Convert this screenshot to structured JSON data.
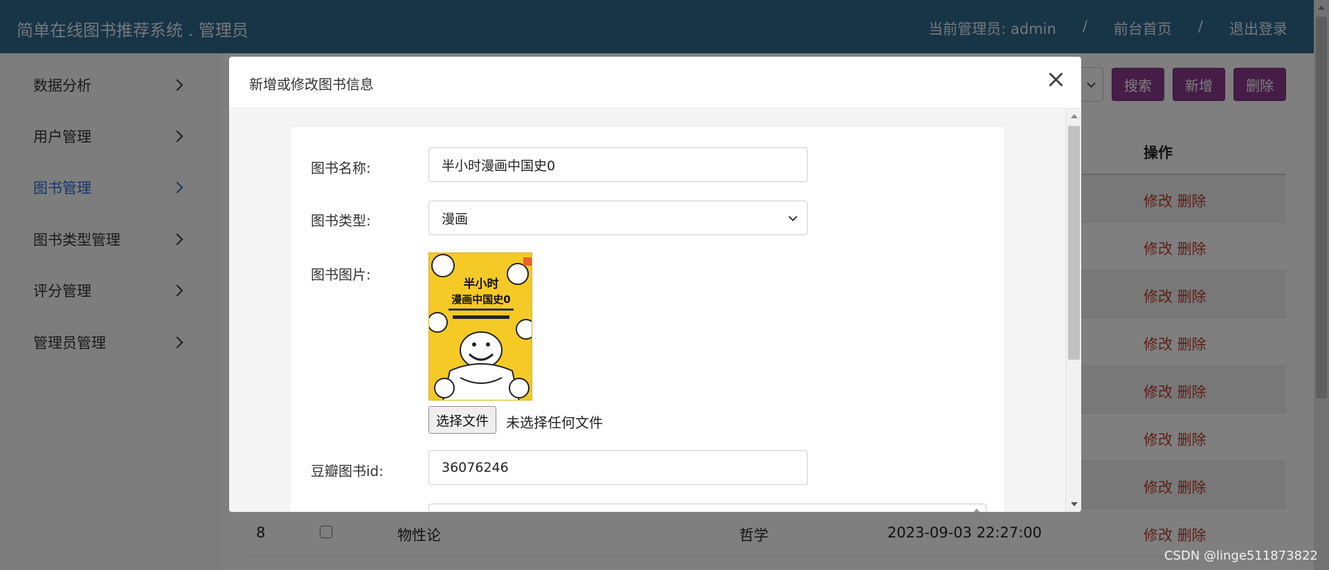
{
  "header": {
    "title": "简单在线图书推荐系统 . 管理员",
    "current_admin": "当前管理员:  admin",
    "sep1": "/",
    "home": "前台首页",
    "sep2": "/",
    "logout": "退出登录"
  },
  "sidebar": {
    "items": [
      {
        "label": "数据分析"
      },
      {
        "label": "用户管理"
      },
      {
        "label": "图书管理"
      },
      {
        "label": "图书类型管理"
      },
      {
        "label": "评分管理"
      },
      {
        "label": "管理员管理"
      }
    ]
  },
  "toolbar": {
    "search_label": "搜索",
    "add_label": "新增",
    "delete_label": "删除"
  },
  "table": {
    "op_header": "操作",
    "edit_label": "修改",
    "delete_label": "删除",
    "last_row": {
      "id": "8",
      "name": "物性论",
      "type": "哲学",
      "time": "2023-09-03 22:27:00"
    }
  },
  "modal": {
    "title": "新增或修改图书信息",
    "fields": {
      "name_label": "图书名称:",
      "name_value": "半小时漫画中国史0",
      "type_label": "图书类型:",
      "type_value": "漫画",
      "image_label": "图书图片:",
      "file_button": "选择文件",
      "file_status": "未选择任何文件",
      "douban_label": "豆瓣图书id:",
      "douban_value": "36076246"
    },
    "cover_text": {
      "line1": "半小时",
      "line2": "漫画中国史0"
    }
  },
  "watermark": "CSDN @linge511873822",
  "colors": {
    "header_bg": "#2e6b8f",
    "button_bg": "#8b3a8e",
    "active_link": "#2a6cd6",
    "action_red": "#c0392b"
  }
}
